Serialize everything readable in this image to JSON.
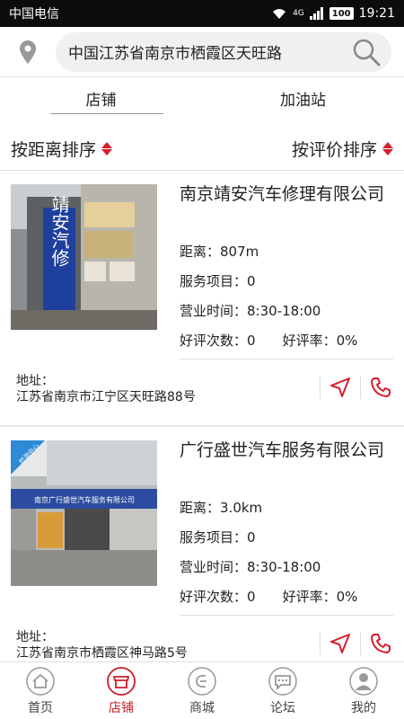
{
  "status_bar": {
    "carrier": "中国电信",
    "network": "4G",
    "battery": "100",
    "time": "19:21"
  },
  "search": {
    "value": "中国江苏省南京市栖霞区天旺路",
    "placeholder": ""
  },
  "tabs": [
    {
      "label": "店铺",
      "active": true
    },
    {
      "label": "加油站",
      "active": false
    }
  ],
  "sort": {
    "distance_label": "按距离排序",
    "rating_label": "按评价排序"
  },
  "labels": {
    "distance": "距离：",
    "services": "服务项目：",
    "hours": "营业时间：",
    "good_count": "好评次数：",
    "good_rate": "好评率：",
    "address": "地址："
  },
  "shops": [
    {
      "name": "南京靖安汽车修理有限公司",
      "distance": "807m",
      "services": "0",
      "hours": "8:30-18:00",
      "good_count": "0",
      "good_rate": "0%",
      "address": "江苏省南京市江宁区天旺路88号",
      "photo_sign": "靖安汽修",
      "badge": ""
    },
    {
      "name": "广行盛世汽车服务有限公司",
      "distance": "3.0km",
      "services": "0",
      "hours": "8:30-18:00",
      "good_count": "0",
      "good_rate": "0%",
      "address": "江苏省南京市栖霞区神马路5号",
      "photo_sign": "南京广行盛世汽车服务有限公司",
      "badge": "检测中心"
    }
  ],
  "nav": [
    {
      "label": "首页",
      "icon": "home-icon",
      "active": false
    },
    {
      "label": "店铺",
      "icon": "shop-icon",
      "active": true
    },
    {
      "label": "商城",
      "icon": "mall-icon",
      "active": false
    },
    {
      "label": "论坛",
      "icon": "forum-icon",
      "active": false
    },
    {
      "label": "我的",
      "icon": "profile-icon",
      "active": false
    }
  ],
  "colors": {
    "accent": "#d81e2c",
    "nav_active": "#c8202b",
    "status_bar_bg": "#0c0c0c"
  }
}
